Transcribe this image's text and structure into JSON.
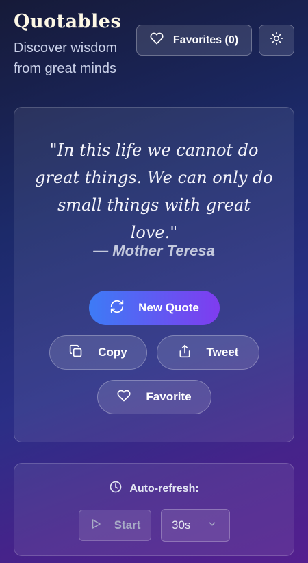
{
  "header": {
    "logo": "Quotables",
    "tagline": "Discover wisdom from great minds",
    "favorites_label": "Favorites (0)",
    "favorites_icon": "heart-icon",
    "theme_icon": "sun-icon"
  },
  "quote": {
    "text": "\"In this life we cannot do great things. We can only do small things with great love.\"",
    "author": "— Mother Teresa"
  },
  "actions": {
    "new_quote_label": "New Quote",
    "new_quote_icon": "refresh-icon",
    "copy_label": "Copy",
    "copy_icon": "copy-icon",
    "tweet_label": "Tweet",
    "tweet_icon": "share-icon",
    "favorite_label": "Favorite",
    "favorite_icon": "heart-icon"
  },
  "auto_refresh": {
    "label": "Auto-refresh:",
    "clock_icon": "clock-icon",
    "start_label": "Start",
    "start_icon": "play-icon",
    "interval_value": "30s",
    "chevron_icon": "chevron-down-icon"
  },
  "colors": {
    "accent_start": "#3d7bf6",
    "accent_end": "#7f3cef",
    "logo": "#fdf8e6"
  }
}
